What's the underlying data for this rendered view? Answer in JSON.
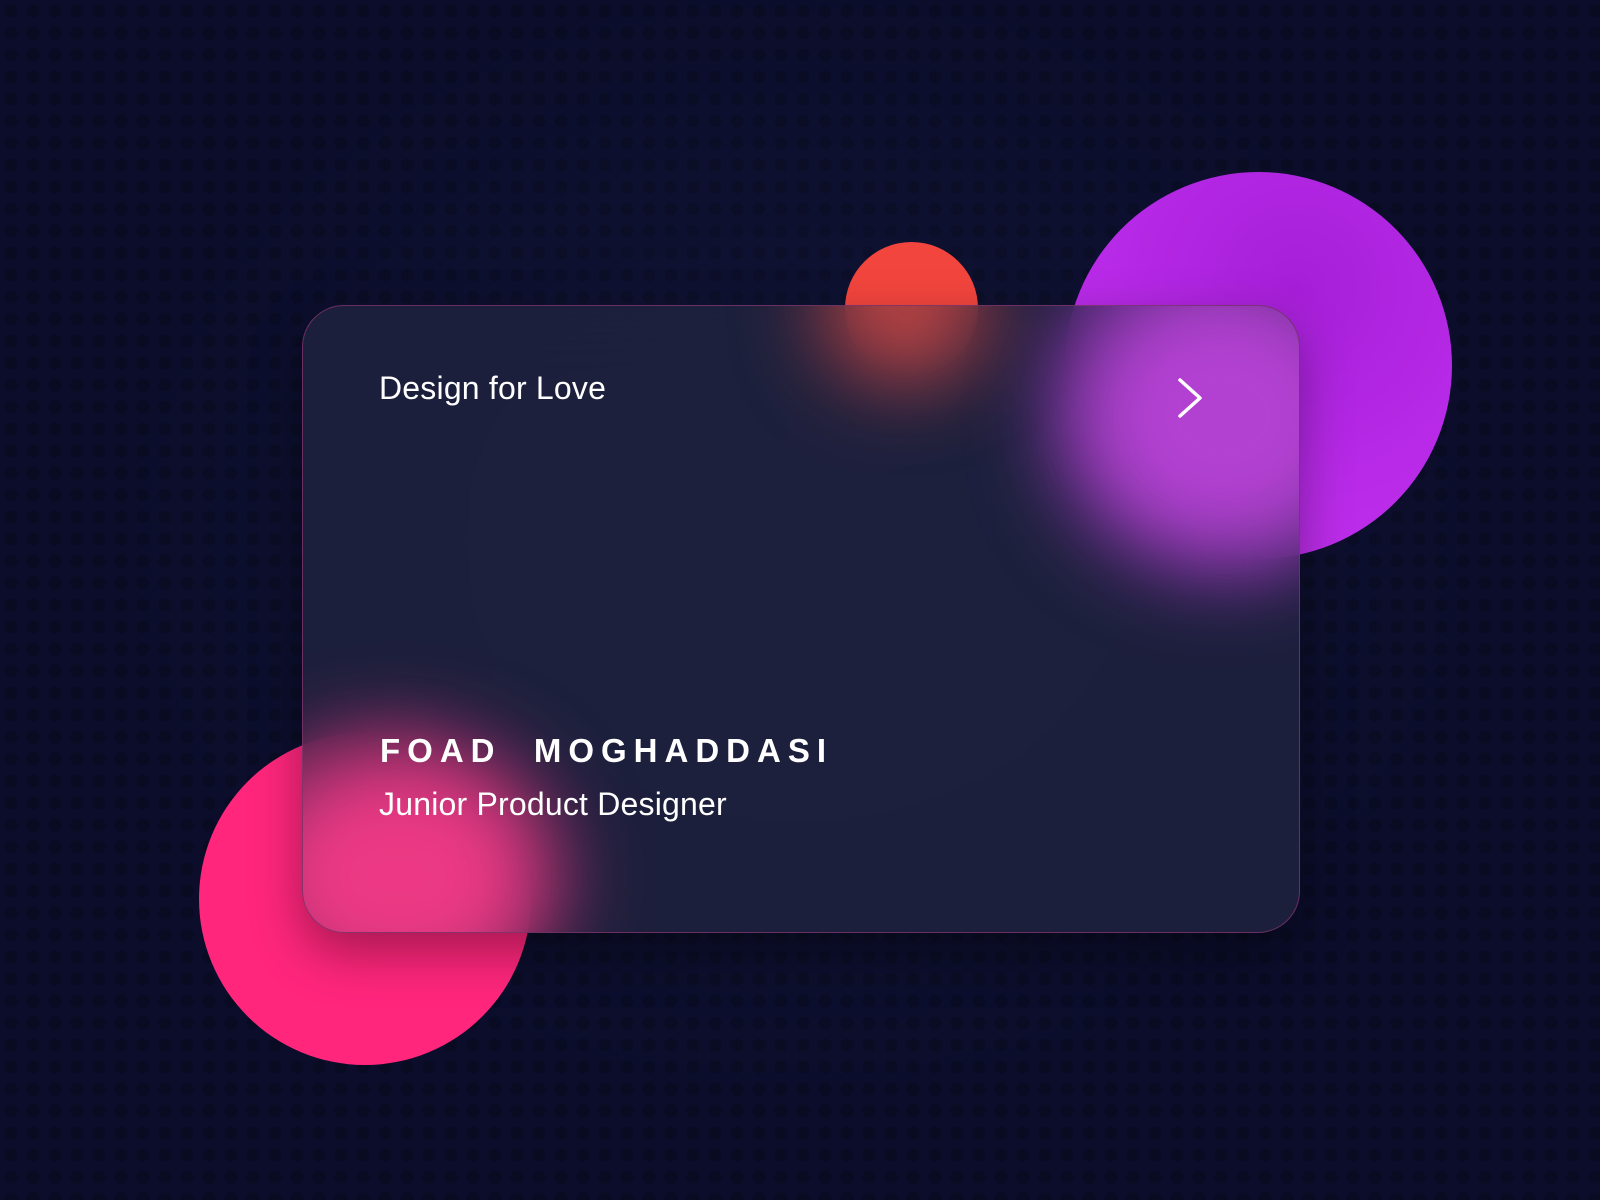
{
  "card": {
    "tagline": "Design for Love",
    "name_first": "FOAD",
    "name_last": "MOGHADDASI",
    "role": "Junior Product Designer",
    "action_icon": "chevron-right-icon"
  },
  "colors": {
    "background": "#0b0d2b",
    "circle_red": "#f2453d",
    "circle_purple": "#b629e6",
    "circle_pink": "#ff267c",
    "card_surface": "#202340",
    "text": "#ffffff"
  }
}
